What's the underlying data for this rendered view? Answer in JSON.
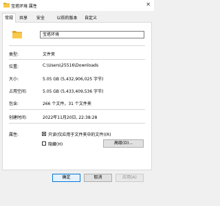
{
  "window": {
    "title": "宝塔环境 属性",
    "close_icon": "close-icon"
  },
  "tabs": [
    {
      "label": "常规",
      "active": true
    },
    {
      "label": "共享"
    },
    {
      "label": "安全"
    },
    {
      "label": "以前的版本"
    },
    {
      "label": "自定义"
    }
  ],
  "general": {
    "folder_name": "宝塔环境",
    "props": [
      {
        "label": "类型:",
        "value": "文件夹"
      },
      {
        "label": "位置:",
        "value": "C:\\Users\\25516\\Downloads"
      },
      {
        "label": "大小:",
        "value": "5.05 GB (5,432,906,025 字节)"
      },
      {
        "label": "占用空间:",
        "value": "5.05 GB (5,433,409,536 字节)"
      },
      {
        "label": "包含:",
        "value": "266 个文件，31 个文件夹"
      },
      {
        "label": "创建时间:",
        "value": "2022年11月20日, 22:38:28"
      }
    ],
    "attributes": {
      "label": "属性:",
      "readonly_label": "只读(仅应用于文件夹中的文件)(R)",
      "readonly_state": "indeterminate",
      "hidden_label": "隐藏(H)",
      "hidden_checked": false,
      "advanced_label": "高级(D)..."
    }
  },
  "buttons": {
    "ok": "确定",
    "cancel": "取消",
    "apply": "应用(A)"
  },
  "colors": {
    "folder": "#f8c94a",
    "folder_dark": "#e0a82e",
    "accent": "#0078d7"
  }
}
